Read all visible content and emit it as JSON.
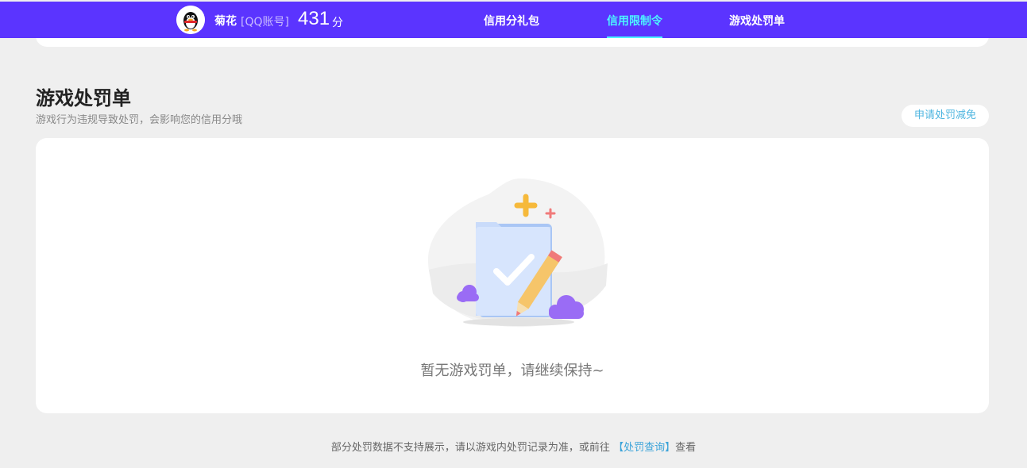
{
  "header": {
    "user_name": "菊花",
    "account_type": "[QQ账号]",
    "score": "431",
    "score_unit": "分",
    "tabs": [
      {
        "label": "信用分礼包",
        "active": false
      },
      {
        "label": "信用限制令",
        "active": true
      },
      {
        "label": "游戏处罚单",
        "active": false
      }
    ]
  },
  "section": {
    "title": "游戏处罚单",
    "subtitle": "游戏行为违规导致处罚，会影响您的信用分哦",
    "apply_button": "申请处罚减免"
  },
  "empty_state": {
    "message": "暂无游戏罚单，请继续保持~",
    "icon": "document-check-pencil-illustration"
  },
  "footer": {
    "text_before": "部分处罚数据不支持展示，请以游戏内处罚记录为准，或前往",
    "link": "【处罚查询】",
    "text_after": "查看"
  },
  "colors": {
    "header_bg": "#5b34ff",
    "active_tab": "#4cf4ff",
    "link": "#3aa3d9",
    "page_bg": "#efefef"
  }
}
